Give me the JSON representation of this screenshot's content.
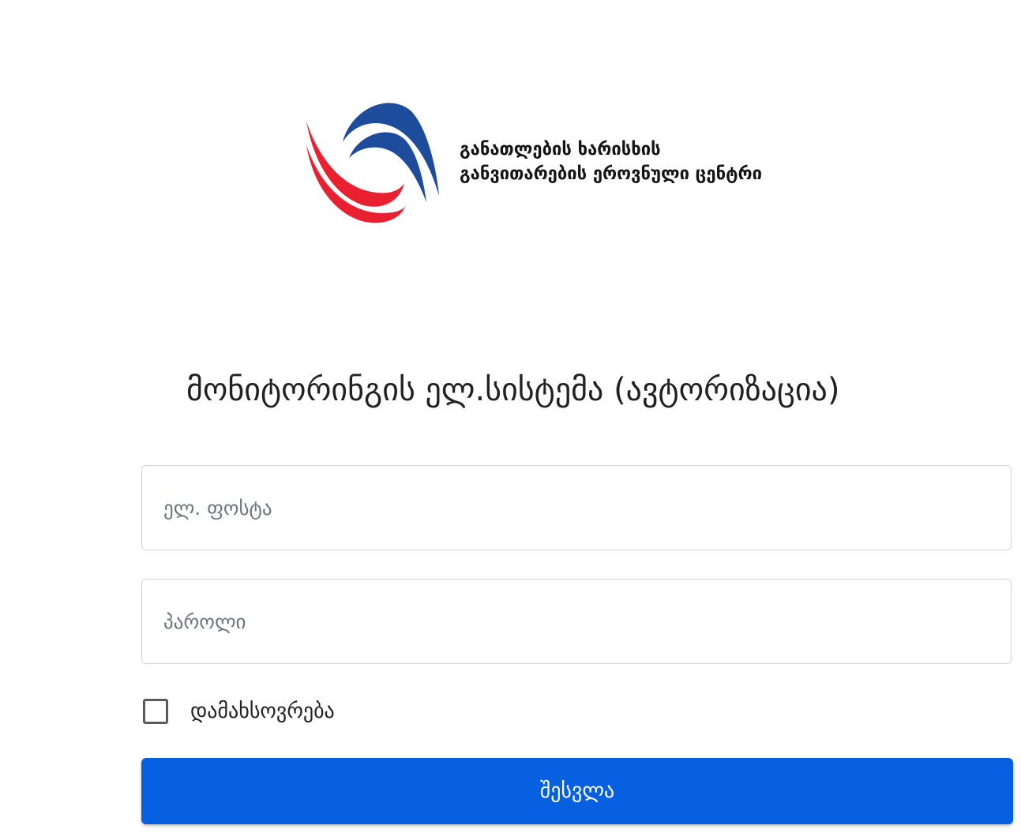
{
  "logo": {
    "line1": "განათლების ხარისხის",
    "line2": "განვითარების ეროვნული ცენტრი",
    "colors": {
      "blue": "#1e4c9c",
      "red": "#e8202f"
    }
  },
  "page_title": "მონიტორინგის ელ.სისტემა (ავტორიზაცია)",
  "form": {
    "email_placeholder": "ელ. ფოსტა",
    "password_placeholder": "პაროლი",
    "remember_label": "დამახსოვრება",
    "remember_checked": false,
    "submit_label": "შესვლა"
  },
  "colors": {
    "button": "#0660e0",
    "field_border": "#cfd3d7"
  }
}
